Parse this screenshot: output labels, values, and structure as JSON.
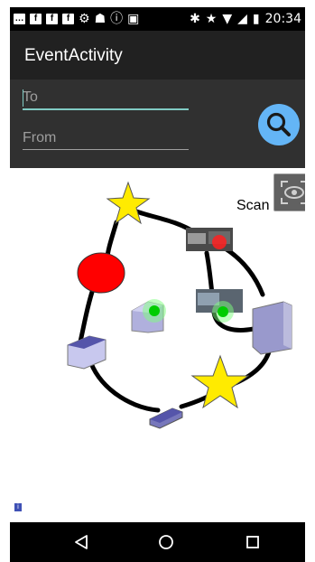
{
  "status_bar": {
    "left_icons": [
      "message-icon",
      "facebook-icon",
      "facebook-icon",
      "facebook-icon",
      "settings-icon",
      "android-icon",
      "info-icon",
      "image-icon"
    ],
    "right_icons": [
      "bluetooth-icon",
      "star-icon",
      "wifi-icon",
      "no-signal-icon",
      "battery-charging-icon"
    ],
    "clock": "20:34"
  },
  "app_bar": {
    "title": "EventActivity"
  },
  "form": {
    "to_placeholder": "To",
    "from_placeholder": "From",
    "search_icon": "search-icon"
  },
  "scan": {
    "label": "Scan",
    "icon": "eye-scan-icon"
  },
  "map": {
    "markers": [
      "star",
      "red-circle",
      "photo-thumbnail",
      "photo-thumbnail",
      "cube",
      "box",
      "star",
      "box",
      "flat-box"
    ],
    "info_badge": "i"
  },
  "nav_bar": {
    "buttons": [
      "back-icon",
      "home-icon",
      "recents-icon"
    ]
  },
  "colors": {
    "accent": "#80cbc4",
    "search": "#64b5f6",
    "app_bar": "#212121",
    "panel": "#303030",
    "star": "#ffeb00",
    "red_marker": "#ff0000",
    "box": "#8888cc"
  }
}
